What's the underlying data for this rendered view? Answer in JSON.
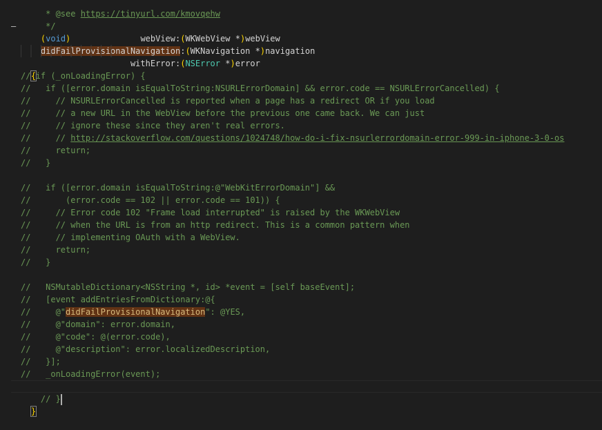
{
  "editor": {
    "header_comments": [
      {
        "prefix": " * @see ",
        "link": "https://tinyurl.com/kmovqehw"
      },
      {
        "prefix": " */",
        "link": ""
      }
    ],
    "signature": {
      "fold_marker": "–",
      "line1_paren_open": "(",
      "line1_type": "void",
      "line1_paren_close": ")",
      "line1_spacing": "              ",
      "line1_method": "webView:",
      "line1_arg_open": "(",
      "line1_arg_class": "WKWebView",
      "line1_arg_ptr": " *",
      "line1_arg_close": ")",
      "line1_arg_name": "webView",
      "line2_method": "didFailProvisionalNavigation",
      "line2_colon": ":",
      "line2_arg_open": "(",
      "line2_arg_class": "WKNavigation",
      "line2_arg_ptr": " *",
      "line2_arg_close": ")",
      "line2_arg_name": "navigation",
      "line3_indent": "                  ",
      "line3_method": "withError:",
      "line3_arg_open": "(",
      "line3_arg_class": "NSError",
      "line3_arg_ptr": " *",
      "line3_arg_close": ")",
      "line3_arg_name": "error"
    },
    "open_brace": "{",
    "close_brace": "}",
    "body_lines": [
      "// if (_onLoadingError) {",
      "//   if ([error.domain isEqualToString:NSURLErrorDomain] && error.code == NSURLErrorCancelled) {",
      "//     // NSURLErrorCancelled is reported when a page has a redirect OR if you load",
      "//     // a new URL in the WebView before the previous one came back. We can just",
      "//     // ignore these since they aren't real errors.",
      "//     // ",
      "//     return;",
      "//   }",
      "",
      "//   if ([error.domain isEqualToString:@\"WebKitErrorDomain\"] &&",
      "//       (error.code == 102 || error.code == 101)) {",
      "//     // Error code 102 \"Frame load interrupted\" is raised by the WKWebView",
      "//     // when the URL is from an http redirect. This is a common pattern when",
      "//     // implementing OAuth with a WebView.",
      "//     return;",
      "//   }",
      "",
      "//   NSMutableDictionary<NSString *, id> *event = [self baseEvent];",
      "//   [event addEntriesFromDictionary:@{",
      "//     @\"",
      "//     @\"domain\": error.domain,",
      "//     @\"code\": @(error.code),",
      "//     @\"description\": error.localizedDescription,",
      "//   }];",
      "//   _onLoadingError(event);",
      "// }"
    ],
    "stackoverflow_link": "http://stackoverflow.com/questions/1024748/how-do-i-fix-nsurlerrordomain-error-999-in-iphone-3-0-os",
    "highlight_key": "didFailProvisionalNavigation",
    "highlight_key_suffix": "\": @YES,"
  }
}
